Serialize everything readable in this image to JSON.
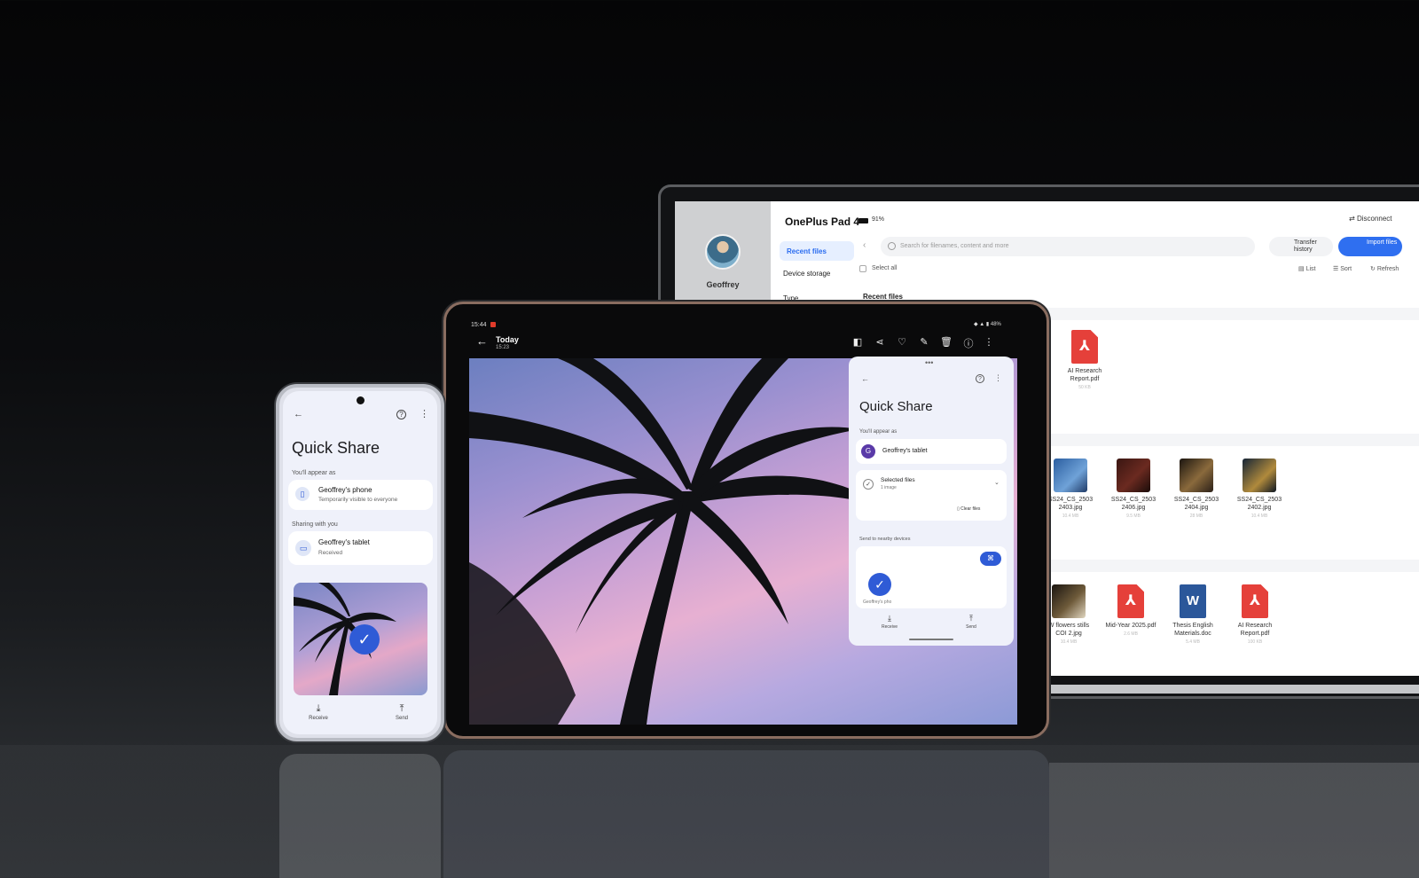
{
  "laptop": {
    "device_title": "OnePlus Pad 4",
    "battery": "91%",
    "disconnect": "Disconnect",
    "user_name": "Geoffrey",
    "nav": [
      "Recent files",
      "Device storage",
      "Type"
    ],
    "search_placeholder": "Search for filenames, content and more",
    "transfer_history": "Transfer history",
    "import_files": "Import files",
    "select_all": "Select all",
    "view_list": "List",
    "sort": "Sort",
    "refresh": "Refresh",
    "section_title": "Recent files",
    "files_row1": [
      {
        "name": "AI Research Report.pdf",
        "size": "50 KB",
        "type": "pdf"
      }
    ],
    "files_row2": [
      {
        "name": "SS24_CS_2503 2403.jpg",
        "size": "10.4 MB",
        "type": "image"
      },
      {
        "name": "SS24_CS_2503 2406.jpg",
        "size": "9.5 MB",
        "type": "image"
      },
      {
        "name": "SS24_CS_2503 2404.jpg",
        "size": "28 MB",
        "type": "image"
      },
      {
        "name": "SS24_CS_2503 2402.jpg",
        "size": "10.4 MB",
        "type": "image"
      }
    ],
    "files_row3": [
      {
        "name": "W flowers stills COI 2.jpg",
        "size": "10.4 MB",
        "type": "image"
      },
      {
        "name": "Mid-Year 2025.pdf",
        "size": "2.6 MB",
        "type": "pdf"
      },
      {
        "name": "Thesis English Materials.doc",
        "size": "5.4 MB",
        "type": "doc"
      },
      {
        "name": "AI Research Report.pdf",
        "size": "100 KB",
        "type": "pdf"
      }
    ]
  },
  "tablet": {
    "status_time": "15:44",
    "status_right": "48%",
    "header_title": "Today",
    "header_time": "15:23",
    "quick_share": {
      "title": "Quick Share",
      "appear_as_label": "You'll appear as",
      "device_initial": "G",
      "device_name": "Geoffrey's tablet",
      "selected_files": "Selected files",
      "selected_count": "1 image",
      "clear_files": "Clear files",
      "send_label": "Send to nearby devices",
      "target_device": "Geoffrey's pho",
      "receive": "Receive",
      "send": "Send"
    }
  },
  "phone": {
    "title": "Quick Share",
    "appear_as_label": "You'll appear as",
    "device_name": "Geoffrey's phone",
    "device_visibility": "Temporarily visible to everyone",
    "sharing_label": "Sharing with you",
    "sharing_device": "Geoffrey's tablet",
    "sharing_status": "Received",
    "receive": "Receive",
    "send": "Send"
  },
  "icons": {
    "back": "←",
    "help": "?",
    "more": "⋮",
    "check": "✓",
    "download": "⤓",
    "upload": "⤒"
  }
}
